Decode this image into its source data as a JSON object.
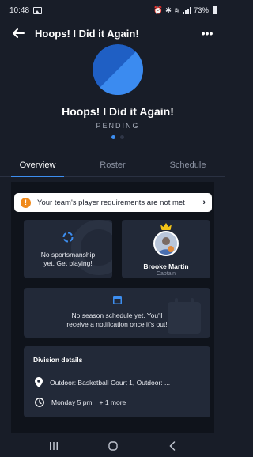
{
  "status_bar": {
    "time": "10:48",
    "battery": "73%",
    "icons": [
      "gallery-icon",
      "alarm-icon",
      "bluetooth-icon",
      "wifi-icon",
      "signal-icon",
      "battery-icon"
    ]
  },
  "header": {
    "title": "Hoops! I Did it Again!",
    "back_icon": "arrow-left-icon",
    "more_label": "•••"
  },
  "team": {
    "name": "Hoops! I Did it Again!",
    "status": "PENDING",
    "logo_colors": [
      "#1f5fc4",
      "#3b8bf0"
    ],
    "carousel_pages": 2,
    "carousel_active": 0
  },
  "tabs": [
    {
      "label": "Overview",
      "active": true
    },
    {
      "label": "Roster",
      "active": false
    },
    {
      "label": "Schedule",
      "active": false
    }
  ],
  "alert": {
    "icon": "!",
    "text": "Your team's player requirements are not met",
    "chevron": "›"
  },
  "sportsmanship": {
    "text_line1": "No sportsmanship",
    "text_line2": "yet. Get playing!"
  },
  "captain": {
    "name": "Brooke Martin",
    "role": "Captain"
  },
  "season_schedule": {
    "text_line1": "No season schedule yet. You'll",
    "text_line2": "receive a notification once it's out!"
  },
  "division": {
    "title": "Division details",
    "location": "Outdoor: Basketball Court 1, Outdoor: ...",
    "time": "Monday 5 pm",
    "time_more": "+ 1 more"
  },
  "colors": {
    "background": "#181d28",
    "accent": "#3d8ef0",
    "warning": "#f08a1c",
    "card": "#222938",
    "crown": "#f5c518"
  }
}
